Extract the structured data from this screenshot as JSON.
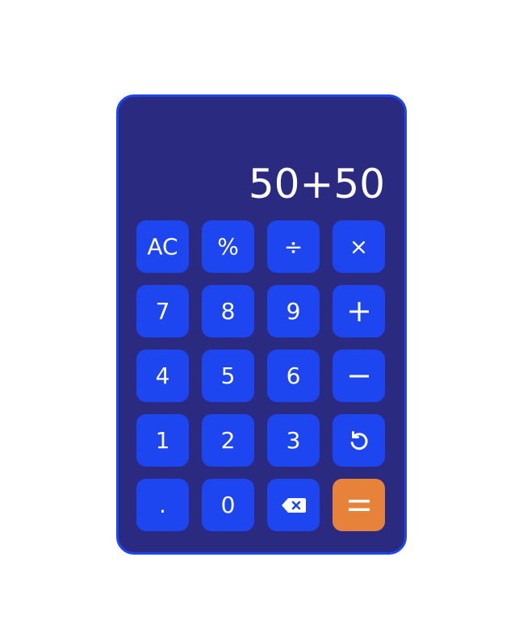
{
  "display": {
    "expression": "50+50"
  },
  "keys": {
    "clear": "AC",
    "percent": "%",
    "divide": "÷",
    "multiply": "×",
    "seven": "7",
    "eight": "8",
    "nine": "9",
    "four": "4",
    "five": "5",
    "six": "6",
    "one": "1",
    "two": "2",
    "three": "3",
    "decimal": ".",
    "zero": "0"
  },
  "icons": {
    "add": "plus-icon",
    "subtract": "minus-icon",
    "undo": "undo-icon",
    "backspace": "backspace-icon",
    "equals": "equals-icon"
  },
  "colors": {
    "body": "#2a2a80",
    "border": "#1d45f0",
    "key": "#1d45f0",
    "equals_key": "#e6823a",
    "text": "#ffffff"
  }
}
